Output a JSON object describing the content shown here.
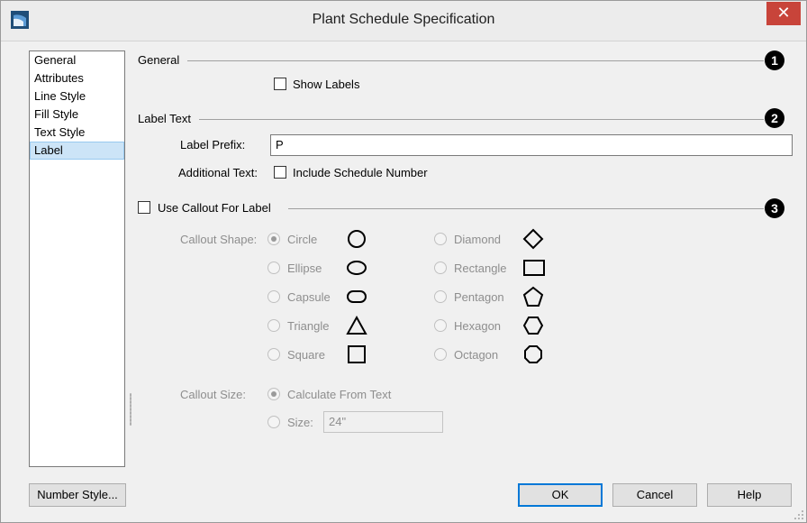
{
  "window": {
    "title": "Plant Schedule Specification",
    "close_symbol": "✕"
  },
  "sidebar": {
    "items": [
      {
        "label": "General"
      },
      {
        "label": "Attributes"
      },
      {
        "label": "Line Style"
      },
      {
        "label": "Fill Style"
      },
      {
        "label": "Text Style"
      },
      {
        "label": "Label",
        "selected": true
      }
    ]
  },
  "sections": {
    "general": {
      "title": "General",
      "badge": "1",
      "show_labels": {
        "label": "Show Labels",
        "checked": false
      }
    },
    "label_text": {
      "title": "Label Text",
      "badge": "2",
      "prefix_label": "Label Prefix:",
      "prefix_value": "P",
      "additional_label": "Additional Text:",
      "include_schedule": {
        "label": "Include Schedule Number",
        "checked": false
      }
    },
    "callout": {
      "title": "Use Callout For Label",
      "badge": "3",
      "checked": false,
      "shape_label": "Callout Shape:",
      "shapes_left": [
        {
          "label": "Circle",
          "icon": "circle-icon",
          "checked": true
        },
        {
          "label": "Ellipse",
          "icon": "ellipse-icon"
        },
        {
          "label": "Capsule",
          "icon": "capsule-icon"
        },
        {
          "label": "Triangle",
          "icon": "triangle-icon"
        },
        {
          "label": "Square",
          "icon": "square-icon"
        }
      ],
      "shapes_right": [
        {
          "label": "Diamond",
          "icon": "diamond-icon"
        },
        {
          "label": "Rectangle",
          "icon": "rectangle-icon"
        },
        {
          "label": "Pentagon",
          "icon": "pentagon-icon"
        },
        {
          "label": "Hexagon",
          "icon": "hexagon-icon"
        },
        {
          "label": "Octagon",
          "icon": "octagon-icon"
        }
      ],
      "size_label": "Callout Size:",
      "calc_from_text": {
        "label": "Calculate From Text",
        "checked": true
      },
      "size_option": {
        "label": "Size:",
        "value": "24\""
      }
    }
  },
  "buttons": {
    "number_style": "Number Style...",
    "ok": "OK",
    "cancel": "Cancel",
    "help": "Help"
  },
  "colors": {
    "close_bg": "#c8443a",
    "selected_bg": "#cce4f7",
    "default_border": "#0078d7",
    "disabled_text": "#8e8e8e"
  }
}
